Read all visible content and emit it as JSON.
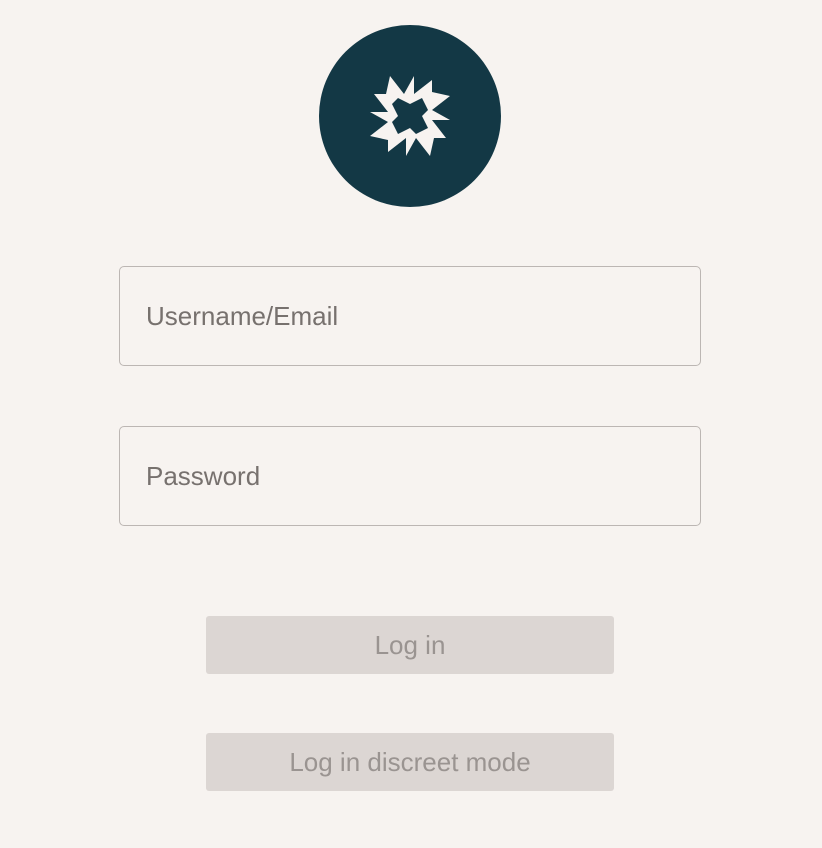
{
  "logo": {
    "icon": "starburst-logo-icon",
    "background_color": "#133845",
    "icon_color": "#f7f3f0"
  },
  "login_form": {
    "username": {
      "value": "",
      "placeholder": "Username/Email"
    },
    "password": {
      "value": "",
      "placeholder": "Password"
    },
    "login_label": "Log in",
    "discreet_label": "Log in discreet mode"
  },
  "colors": {
    "page_background": "#f7f3f0",
    "field_border": "#bcb6b3",
    "button_background": "#dcd6d3",
    "button_text": "#9a9491"
  }
}
